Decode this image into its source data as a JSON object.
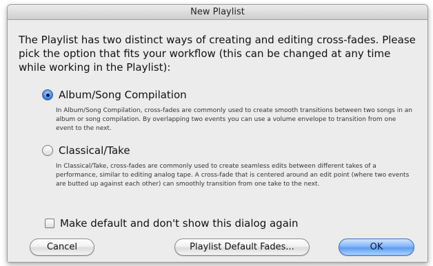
{
  "window": {
    "title": "New Playlist"
  },
  "intro": "The Playlist has two distinct ways of creating and editing cross-fades. Please pick the option that fits your workflow (this can be changed at any time while working in the Playlist):",
  "options": [
    {
      "label": "Album/Song Compilation",
      "selected": true,
      "description": "In Album/Song Compilation, cross-fades are commonly used to create smooth transitions between two songs in an album or song compilation.  By overlapping two events you can use a volume envelope to transition from one event to the next."
    },
    {
      "label": "Classical/Take",
      "selected": false,
      "description": "In Classical/Take, cross-fades are commonly used to create seamless edits between different takes of a performance, similar to editing analog tape.  A cross-fade that is centered around an edit point (where two events are butted up against each other) can smoothly transition from one take to the next."
    }
  ],
  "checkbox": {
    "label": "Make default and don't show this dialog again",
    "checked": false
  },
  "buttons": {
    "cancel": "Cancel",
    "default_fades": "Playlist Default Fades...",
    "ok": "OK"
  },
  "colors": {
    "default_button": "#5f9cf0",
    "window_bg": "#ececec"
  }
}
